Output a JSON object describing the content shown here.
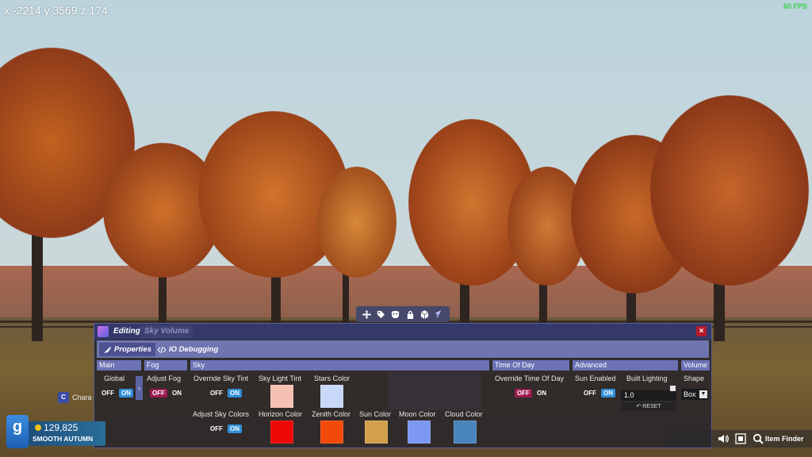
{
  "hud": {
    "coords": "x -2214 y 3569 z 174",
    "fps": "60 FPS"
  },
  "toolbar": {
    "tools": [
      "move-icon",
      "tag-icon",
      "mask-icon",
      "lock-icon",
      "cube-icon",
      "flag-icon"
    ]
  },
  "editor": {
    "title_label": "Editing",
    "title_tab": "Sky Volume",
    "close_label": "×",
    "tabs": [
      {
        "label": "Properties",
        "icon": "brush-icon"
      },
      {
        "label": "IO Debugging",
        "icon": "code-icon"
      }
    ],
    "sections": {
      "main": "Main",
      "fog": "Fog",
      "sky": "Sky",
      "time_of_day": "Time Of Day",
      "advanced": "Advanced",
      "volume": "Volume"
    },
    "fields": {
      "global": "Global",
      "adjust_fog": "Adjust Fog",
      "override_sky_tint": "Override Sky Tint",
      "sky_light_tint": "Sky Light Tint",
      "stars_color": "Stars Color",
      "adjust_sky_colors": "Adjust Sky Colors",
      "horizon_color": "Horizon Color",
      "zenith_color": "Zenith Color",
      "sun_color": "Sun Color",
      "moon_color": "Moon Color",
      "cloud_color": "Cloud Color",
      "override_time_of_day": "Override Time Of Day",
      "sun_enabled": "Sun Enabled",
      "built_lighting": "Built Lighting",
      "shape": "Shape"
    },
    "toggle_off": "OFF",
    "toggle_on": "ON",
    "toggle_states": {
      "global": "on",
      "adjust_fog": "off",
      "override_sky_tint": "on",
      "adjust_sky_colors": "on",
      "override_time_of_day": "off",
      "sun_enabled": "on"
    },
    "colors": {
      "sky_light_tint": "#f6c0b2",
      "stars_color": "#c8d8f8",
      "horizon_color": "#ee0707",
      "zenith_color": "#f24a0a",
      "sun_color": "#d2a04a",
      "moon_color": "#7c98f2",
      "cloud_color": "#4a84bc"
    },
    "built_lighting_value": "1.0",
    "reset_label": "RESET",
    "shape_value": "Box",
    "arrow_label": "›"
  },
  "footer": {
    "char_key": "C",
    "char_label": "Chara",
    "gm_letter": "g",
    "money": "129,825",
    "server": "SMOOTH AUTUMN",
    "item_finder": "Item Finder",
    "icons": [
      "volume-icon",
      "screenshot-icon",
      "search-icon"
    ]
  }
}
